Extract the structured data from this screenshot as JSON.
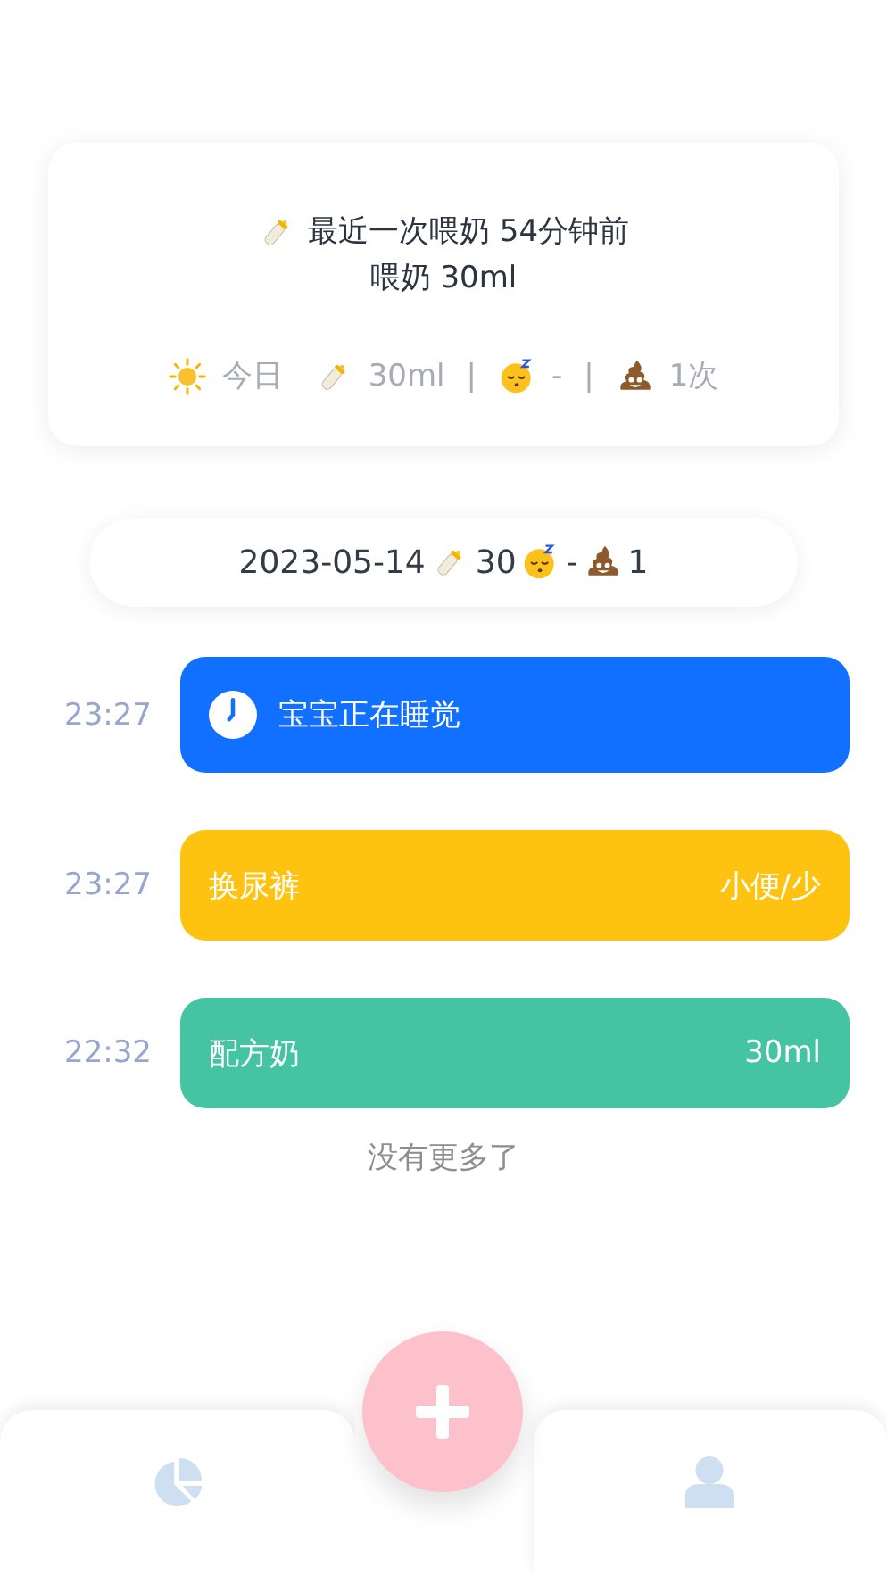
{
  "summary_card": {
    "last_feed": "最近一次喂奶 54分钟前",
    "last_feed_detail": "喂奶 30ml",
    "today": {
      "label": "今日",
      "milk": "30ml",
      "separator_1": "|",
      "sleep": "-",
      "separator_2": "|",
      "poop": "1次"
    }
  },
  "day_header": {
    "date": "2023-05-14",
    "milk": "30",
    "sleep": "-",
    "poop": "1"
  },
  "events": [
    {
      "time": "23:27",
      "kind": "sleep",
      "title": "宝宝正在睡觉",
      "color": "#1170ff"
    },
    {
      "time": "23:27",
      "kind": "diaper",
      "title": "换尿裤",
      "detail": "小便/少",
      "color": "#fec311"
    },
    {
      "time": "22:32",
      "kind": "feed",
      "title": "配方奶",
      "detail": "30ml",
      "color": "#45c4a3"
    }
  ],
  "end_note": "没有更多了",
  "tab_bar": {
    "tabs": [
      {
        "kind": "stats",
        "selected": false
      },
      {
        "kind": "profile",
        "selected": false
      }
    ]
  }
}
